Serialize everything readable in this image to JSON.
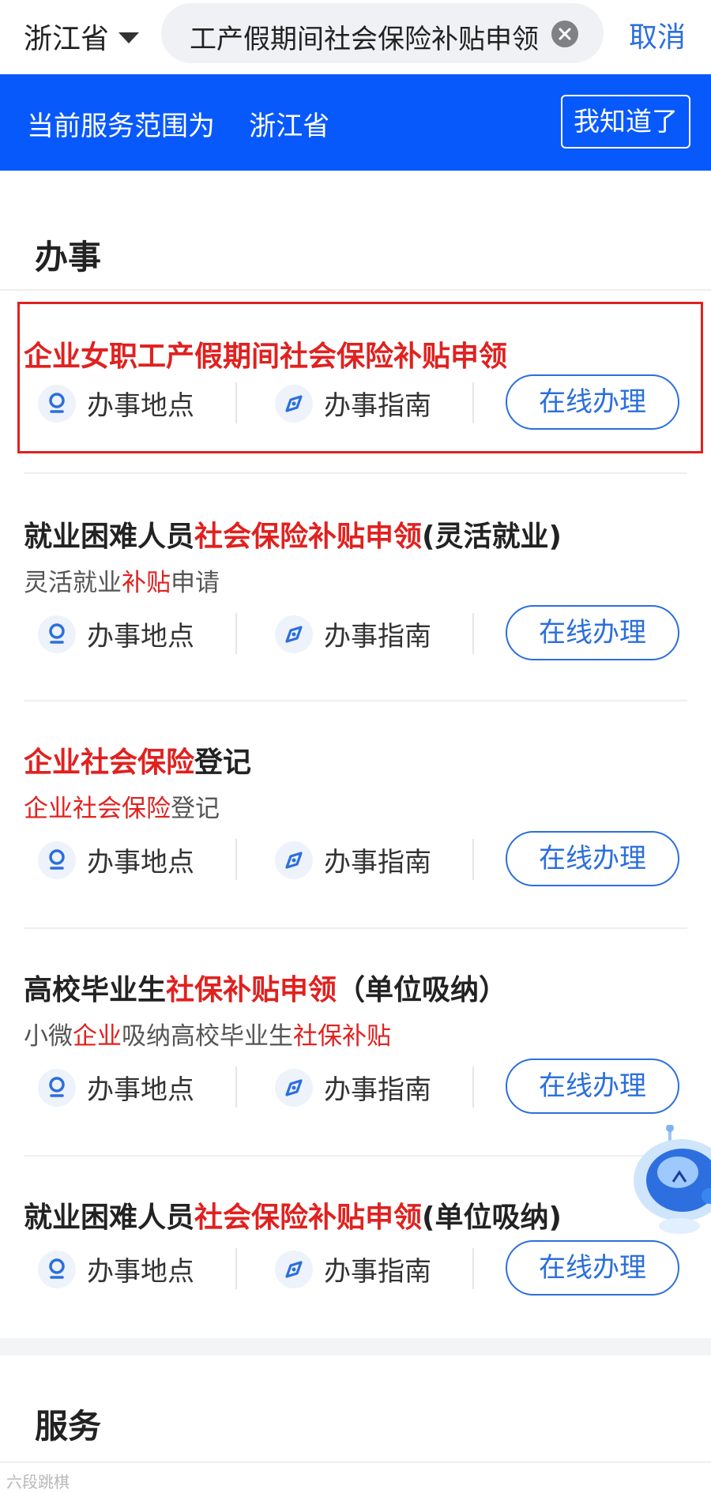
{
  "header": {
    "province": "浙江省",
    "search_text": "工产假期间社会保险补贴申领",
    "cancel_label": "取消"
  },
  "banner": {
    "text": "当前服务范围为    浙江省",
    "ack_label": "我知道了"
  },
  "sections": {
    "banshi": "办事",
    "fuwu": "服务"
  },
  "actions": {
    "location": "办事地点",
    "guide": "办事指南",
    "online": "在线办理"
  },
  "items": [
    {
      "title": [
        {
          "t": "企业女职工产假期间社会保险补贴申领",
          "red": true
        }
      ],
      "subtitle": null,
      "highlighted": true
    },
    {
      "title": [
        {
          "t": "就业困难人员",
          "red": false
        },
        {
          "t": "社会保险补贴申领",
          "red": true
        },
        {
          "t": "(灵活就业)",
          "red": false
        }
      ],
      "subtitle": [
        {
          "t": "灵活就业",
          "red": false
        },
        {
          "t": "补贴",
          "red": true
        },
        {
          "t": "申请",
          "red": false
        }
      ]
    },
    {
      "title": [
        {
          "t": "企业社会保险",
          "red": true
        },
        {
          "t": "登记",
          "red": false
        }
      ],
      "subtitle": [
        {
          "t": "企业社会保险",
          "red": true
        },
        {
          "t": "登记",
          "red": false
        }
      ]
    },
    {
      "title": [
        {
          "t": "高校毕业生",
          "red": false
        },
        {
          "t": "社保补贴申领",
          "red": true
        },
        {
          "t": "（单位吸纳）",
          "red": false
        }
      ],
      "subtitle": [
        {
          "t": "小微",
          "red": false
        },
        {
          "t": "企业",
          "red": true
        },
        {
          "t": "吸纳高校毕业生",
          "red": false
        },
        {
          "t": "社保补贴",
          "red": true
        }
      ]
    },
    {
      "title": [
        {
          "t": "就业困难人员",
          "red": false
        },
        {
          "t": "社会保险补贴申领",
          "red": true
        },
        {
          "t": "(单位吸纳)",
          "red": false
        }
      ],
      "subtitle": null
    }
  ],
  "watermark": "六段跳棋",
  "colors": {
    "brand_blue": "#0859fb",
    "link_blue": "#2b6fdc",
    "highlight_red": "#e0211f"
  },
  "icons": {
    "location": "location-pin-icon",
    "guide": "compass-icon",
    "clear": "clear-circle-icon",
    "dropdown": "caret-down-icon",
    "assistant": "robot-assistant-icon"
  }
}
